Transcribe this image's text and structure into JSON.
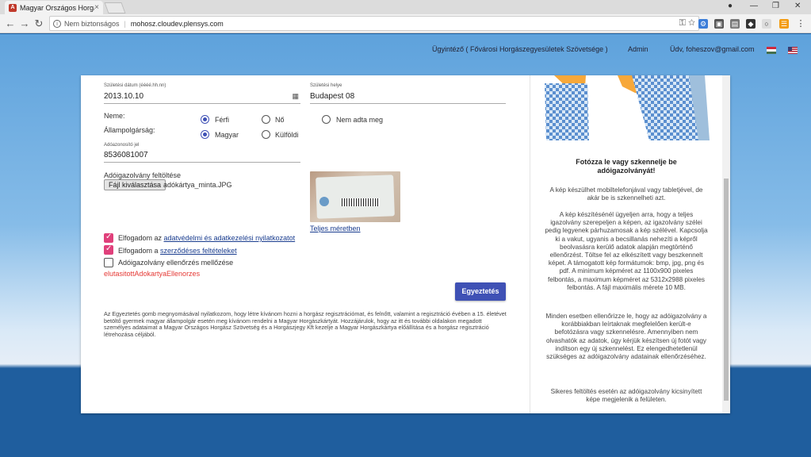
{
  "browser": {
    "tab_title": "Magyar Országos Horgász",
    "tab_close": "×",
    "security": "Nem biztonságos",
    "url": "mohosz.cloudev.plensys.com"
  },
  "topnav": {
    "user": "Ügyintéző ( Fővárosi Horgászegyesületek Szövetsége )",
    "admin": "Admin",
    "greeting": "Üdv, foheszov@gmail.com"
  },
  "form": {
    "birth_date_label": "Születési dátum (éééé.hh.nn)",
    "birth_date_value": "2013.10.10",
    "birth_place_label": "Születési helye",
    "birth_place_value": "Budapest 08",
    "gender_label": "Neme:",
    "gender_options": [
      "Férfi",
      "Nő",
      "Nem adta meg"
    ],
    "citizenship_label": "Állampolgárság:",
    "citizenship_options": [
      "Magyar",
      "Külföldi"
    ],
    "tax_label": "Adóazonosító jel",
    "tax_value": "8536081007",
    "upload_label": "Adóigazolvány feltöltése",
    "file_button": "Fájl kiválasztása",
    "file_name": "adókártya_minta.JPG",
    "full_size_link": "Teljes méretben",
    "cb1_pre": "Elfogadom az ",
    "cb1_link": "adatvédelmi és adatkezelési nyilatkozatot",
    "cb2_pre": "Elfogadom a ",
    "cb2_link": "szerződéses feltételeket",
    "cb3": "Adóigazolvány ellenőrzés mellőzése",
    "error": "elutasitottAdokartyaEllenorzes",
    "submit": "Egyeztetés",
    "legal": "Az Egyeztetés gomb megnyomásával nyilatkozom, hogy létre kívánom hozni a horgász regisztrációmat, és felnőtt, valamint a regisztráció évében a 15. életévet betöltő gyermek magyar állampolgár esetén meg kívánom rendelni a Magyar Horgászkártyát. Hozzájárulok, hogy az itt és további oldalakon megadott személyes adataimat a Magyar Országos Horgász Szövetség és a Horgászjegy Kft kezelje a Magyar Horgászkártya előállítása és a horgász regisztráció létrehozása céljából."
  },
  "side": {
    "title": "Fotózza le vagy szkennelje be adóigazolványát!",
    "p1": "A kép készülhet mobiltelefonjával vagy tabletjével, de akár be is szkennelheti azt.",
    "p2": "A kép készítésénél ügyeljen arra, hogy a teljes igazolvány szerepeljen a képen, az igazolvány szélei pedig legyenek párhuzamosak a kép szélével. Kapcsolja ki a vakut, ugyanis a becsillanás nehezíti a képről beolvasásra kerülő adatok alapján megtörténő ellenőrzést. Töltse fel az elkészített vagy beszkennelt képet. A támogatott kép formátumok: bmp, jpg, png és pdf. A minimum képméret az 1100x900 pixeles felbontás, a maximum képméret az 5312x2988 pixeles felbontás. A fájl maximális mérete 10 MB.",
    "p3": "Minden esetben ellenőrizze le, hogy az adóigazolvány a korábbiakban leírtaknak megfelelően került-e befotózásra vagy szkennelésre. Amennyiben nem olvashatók az adatok, úgy kérjük készítsen új fotót vagy indítson egy új szkennelést. Ez elengedhetetlenül szükséges az adóigazolvány adatainak ellenőrzéséhez.",
    "p4": "Sikeres feltöltés esetén az adóigazolvány kicsinyített képe megjelenik a felületen."
  }
}
